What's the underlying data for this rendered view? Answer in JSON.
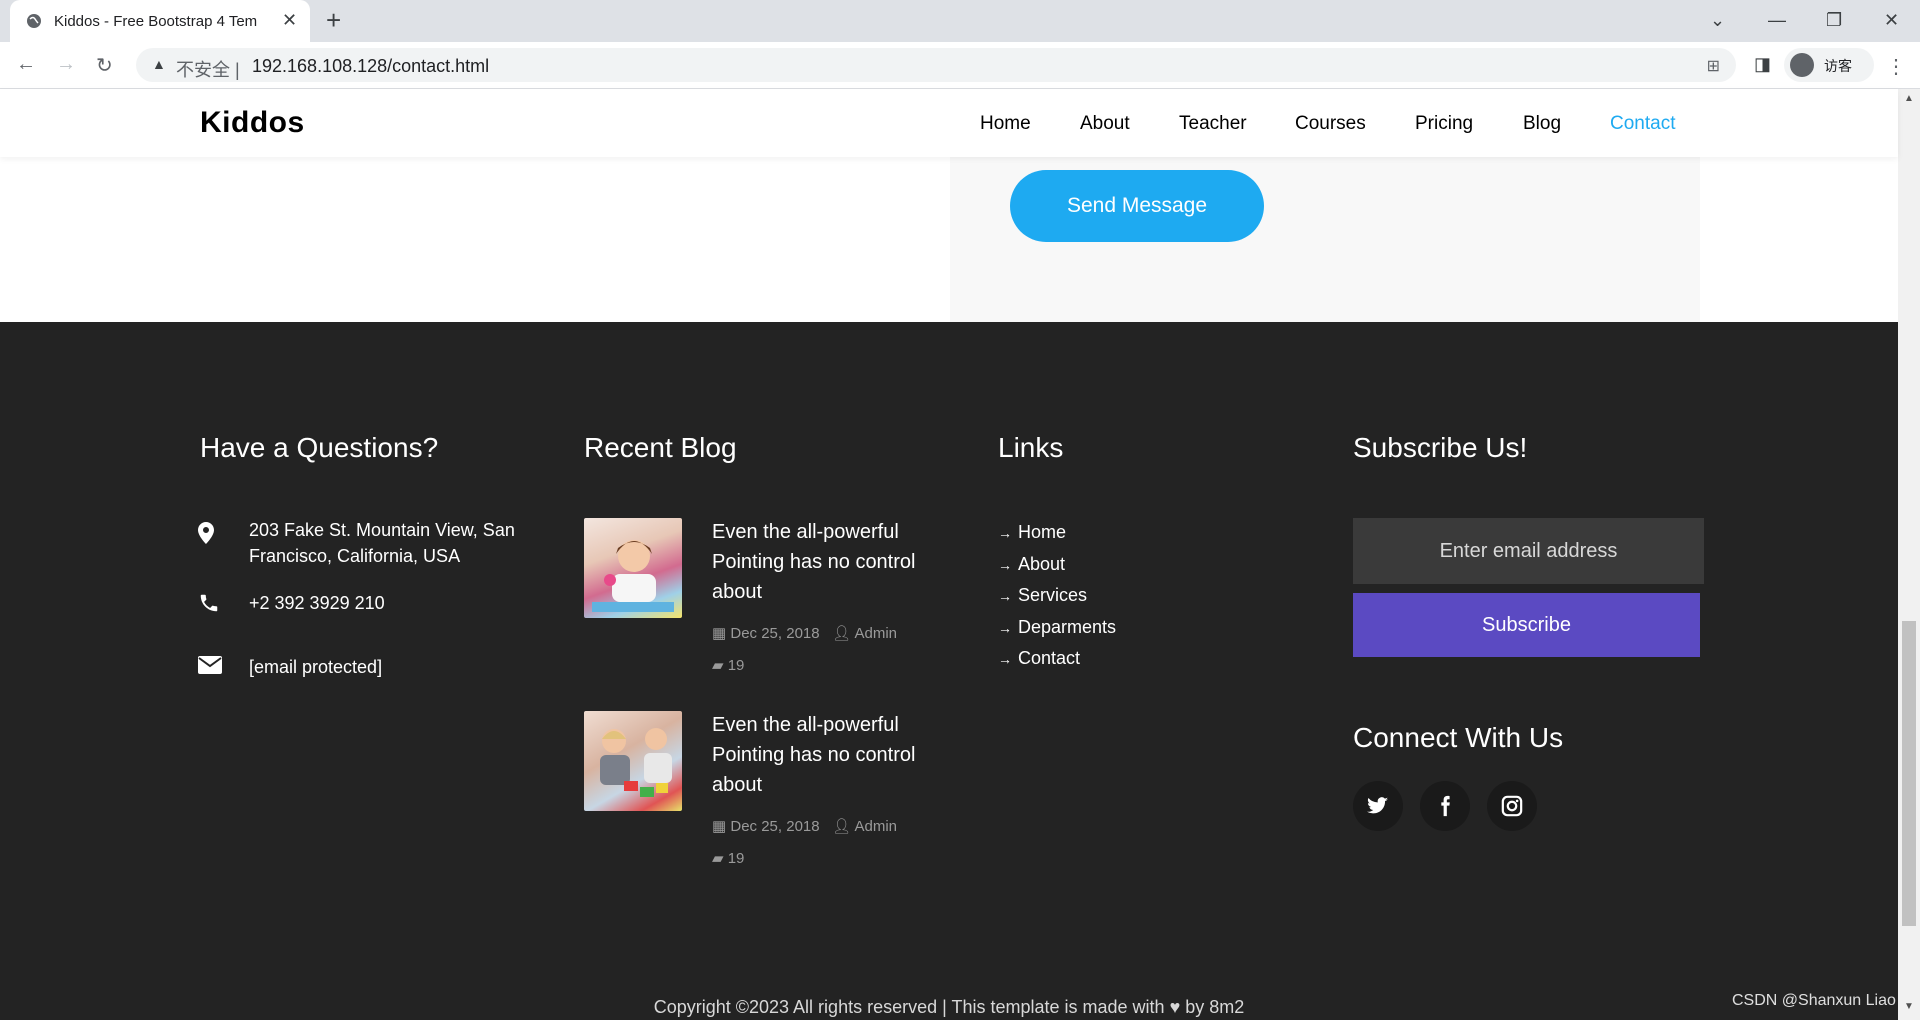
{
  "browser": {
    "tab_title": "Kiddos - Free Bootstrap 4 Tem",
    "security_label": "不安全",
    "url": "192.168.108.128/contact.html",
    "profile_name": "访客"
  },
  "site": {
    "logo": "Kiddos",
    "nav": [
      {
        "label": "Home",
        "active": false
      },
      {
        "label": "About",
        "active": false
      },
      {
        "label": "Teacher",
        "active": false
      },
      {
        "label": "Courses",
        "active": false
      },
      {
        "label": "Pricing",
        "active": false
      },
      {
        "label": "Blog",
        "active": false
      },
      {
        "label": "Contact",
        "active": true
      }
    ],
    "accent_color": "#1eaaf1"
  },
  "contact_form": {
    "send_button": "Send Message"
  },
  "footer": {
    "questions": {
      "title": "Have a Questions?",
      "address": "203 Fake St. Mountain View, San Francisco, California, USA",
      "phone": "+2 392 3929 210",
      "email": "[email protected]"
    },
    "recent_blog": {
      "title": "Recent Blog",
      "posts": [
        {
          "title": "Even the all-powerful Pointing has no control about",
          "date": "Dec 25, 2018",
          "author": "Admin",
          "comments": "19"
        },
        {
          "title": "Even the all-powerful Pointing has no control about",
          "date": "Dec 25, 2018",
          "author": "Admin",
          "comments": "19"
        }
      ]
    },
    "links": {
      "title": "Links",
      "items": [
        "Home",
        "About",
        "Services",
        "Deparments",
        "Contact"
      ]
    },
    "subscribe": {
      "title": "Subscribe Us!",
      "placeholder": "Enter email address",
      "button": "Subscribe",
      "button_color": "#5b4ac2"
    },
    "connect": {
      "title": "Connect With Us",
      "icons": [
        "twitter-icon",
        "facebook-icon",
        "instagram-icon"
      ]
    },
    "copyright_before": "Copyright ©2023 All rights reserved | This template is made with",
    "copyright_after": "by 8m2"
  },
  "watermark": "CSDN @Shanxun Liao"
}
